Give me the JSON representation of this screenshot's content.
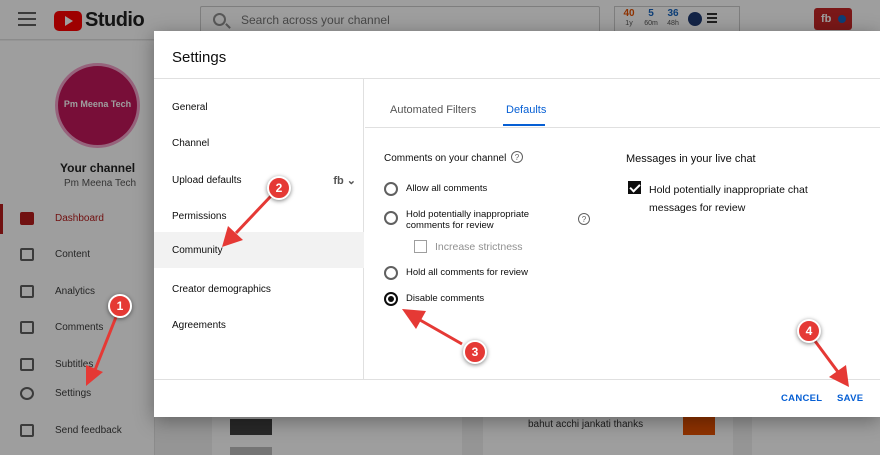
{
  "topbar": {
    "logo_text": "Studio",
    "search_placeholder": "Search across your channel",
    "extension_stats": [
      {
        "value": "40",
        "label": "1y",
        "color": "#e65100"
      },
      {
        "value": "5",
        "label": "60m",
        "color": "#1565c0"
      },
      {
        "value": "36",
        "label": "48h",
        "color": "#1565c0"
      }
    ],
    "create_label": "fb"
  },
  "sidebar": {
    "avatar_text": "Pm Meena Tech",
    "channel_label": "Your channel",
    "channel_name": "Pm Meena Tech",
    "items": [
      {
        "label": "Dashboard",
        "icon": "dashboard-icon",
        "active": true
      },
      {
        "label": "Content",
        "icon": "content-icon"
      },
      {
        "label": "Analytics",
        "icon": "analytics-icon"
      },
      {
        "label": "Comments",
        "icon": "comments-icon"
      },
      {
        "label": "Subtitles",
        "icon": "subtitles-icon"
      },
      {
        "label": "Settings",
        "icon": "gear-icon"
      },
      {
        "label": "Send feedback",
        "icon": "feedback-icon"
      }
    ]
  },
  "background": {
    "comment_snippet": "bahut acchi jankati thanks"
  },
  "dialog": {
    "title": "Settings",
    "nav": [
      {
        "label": "General"
      },
      {
        "label": "Channel"
      },
      {
        "label": "Upload defaults",
        "extra": "fb"
      },
      {
        "label": "Permissions"
      },
      {
        "label": "Community",
        "selected": true
      },
      {
        "label": "Creator demographics"
      },
      {
        "label": "Agreements"
      }
    ],
    "tabs": [
      {
        "label": "Automated Filters",
        "active": false
      },
      {
        "label": "Defaults",
        "active": true
      }
    ],
    "comments_section": {
      "title": "Comments on your channel",
      "options": [
        {
          "label": "Allow all comments",
          "checked": false
        },
        {
          "label": "Hold potentially inappropriate comments for review",
          "line1": "Hold potentially inappropriate",
          "line2": "comments for review",
          "checked": false
        },
        {
          "label": "Hold all comments for review",
          "checked": false
        },
        {
          "label": "Disable comments",
          "checked": true
        }
      ],
      "strictness_label": "Increase strictness"
    },
    "live_chat_section": {
      "title": "Messages in your live chat",
      "option_line1": "Hold potentially inappropriate chat",
      "option_line2": "messages for review",
      "checked": true
    },
    "buttons": {
      "cancel": "CANCEL",
      "save": "SAVE"
    }
  },
  "annotations": {
    "badges": [
      "1",
      "2",
      "3",
      "4"
    ],
    "color": "#e53935"
  }
}
